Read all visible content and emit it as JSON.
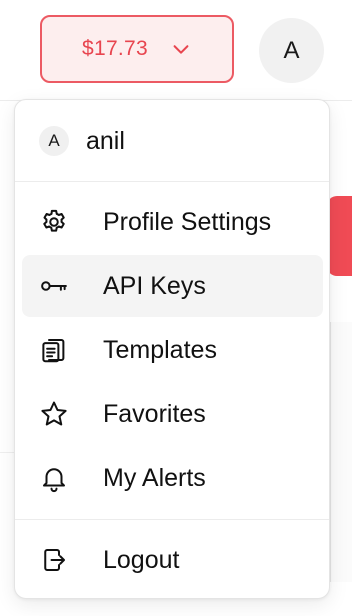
{
  "header": {
    "balance": "$17.73",
    "avatar_initial": "A"
  },
  "menu": {
    "user": {
      "initial": "A",
      "name": "anil"
    },
    "items": [
      {
        "label": "Profile Settings",
        "icon": "gear-icon"
      },
      {
        "label": "API Keys",
        "icon": "key-icon",
        "active": true
      },
      {
        "label": "Templates",
        "icon": "document-icon"
      },
      {
        "label": "Favorites",
        "icon": "star-icon"
      },
      {
        "label": "My Alerts",
        "icon": "bell-icon"
      }
    ],
    "logout": {
      "label": "Logout",
      "icon": "logout-icon"
    }
  },
  "colors": {
    "accent": "#e8454f",
    "accent_bg": "#fdeeee",
    "hover_bg": "#f4f4f4",
    "text": "#111111"
  }
}
